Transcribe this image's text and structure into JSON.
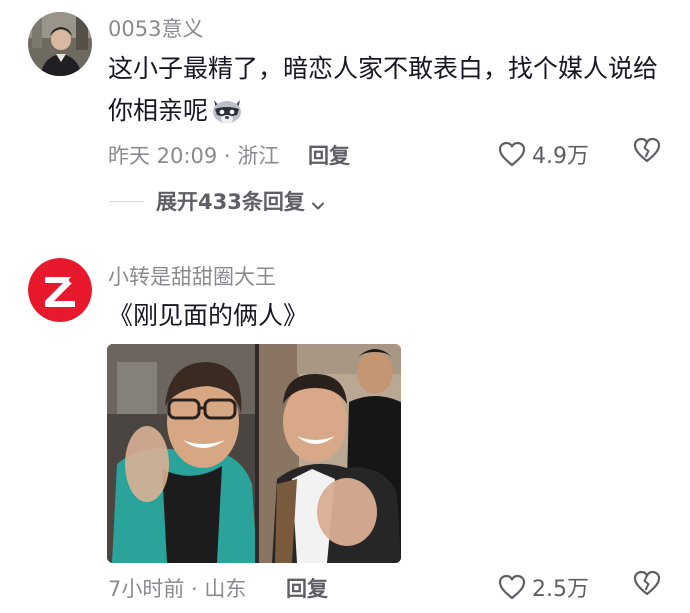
{
  "comments": [
    {
      "username": "0053意义",
      "text": "这小子最精了，暗恋人家不敢表白，找个媒人说给你相亲呢",
      "emoji_icon": "raccoon-emoji-icon",
      "time_location": "昨天 20:09 · 浙江",
      "reply_label": "回复",
      "like_count": "4.9万",
      "expand_label": "展开433条回复",
      "expand_icon": "chevron-down-icon"
    },
    {
      "username": "小转是甜甜圈大王",
      "text": "《刚见面的俩人》",
      "attachment": "photo-two-men-smiling-pointing",
      "time_location": "7小时前 · 山东",
      "reply_label": "回复",
      "like_count": "2.5万"
    }
  ],
  "icons": {
    "like": "heart-outline-icon",
    "dislike": "broken-heart-icon"
  },
  "colors": {
    "text_primary": "#161823",
    "text_secondary": "#8a8b91",
    "avatar_brand_red": "#e8192c"
  }
}
